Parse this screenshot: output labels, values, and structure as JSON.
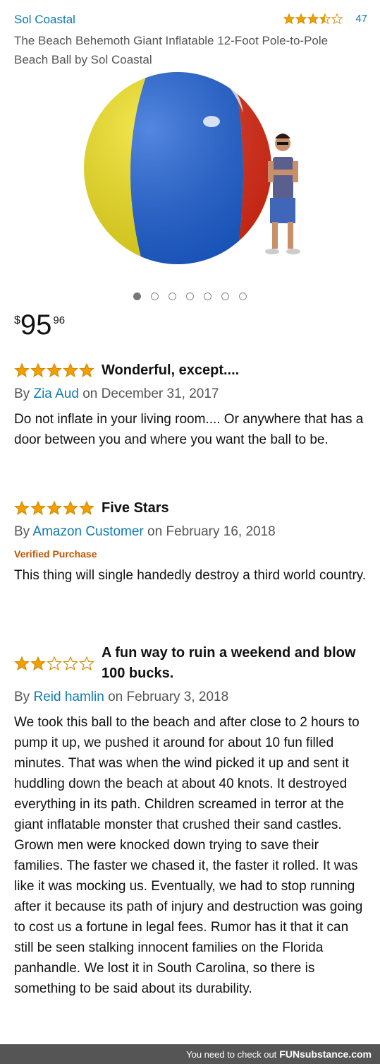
{
  "header": {
    "brand": "Sol Coastal",
    "rating": 3.5,
    "rating_count": "47",
    "product_title": "The Beach Behemoth Giant Inflatable 12-Foot Pole-to-Pole Beach Ball by Sol Coastal"
  },
  "carousel": {
    "total": 7,
    "active_index": 0
  },
  "price": {
    "symbol": "$",
    "whole": "95",
    "fraction": "96"
  },
  "reviews": [
    {
      "stars": 5,
      "title": "Wonderful, except....",
      "by": "By",
      "author": "Zia Aud",
      "date": "on December 31, 2017",
      "verified": "",
      "body": "Do not inflate in your living room.... Or anywhere that has a door between you and where you want the ball to be."
    },
    {
      "stars": 5,
      "title": "Five Stars",
      "by": "By",
      "author": "Amazon Customer",
      "date": "on February 16, 2018",
      "verified": "Verified Purchase",
      "body": "This thing will single handedly destroy a third world country."
    },
    {
      "stars": 2,
      "title": "A fun way to ruin a weekend and blow 100 bucks.",
      "by": "By",
      "author": "Reid hamlin",
      "date": "on February 3, 2018",
      "verified": "",
      "body": "We took this ball to the beach and after close to 2 hours to pump it up, we pushed it around for about 10 fun filled minutes. That was when the wind picked it up and sent it huddling down the beach at about 40 knots. It destroyed everything in its path. Children screamed in terror at the giant inflatable monster that crushed their sand castles. Grown men were knocked down trying to save their families. The faster we chased it, the faster it rolled. It was like it was mocking us. Eventually, we had to stop running after it because its path of injury and destruction was going to cost us a fortune in legal fees. Rumor has it that it can still be seen stalking innocent families on the Florida panhandle. We lost it in South Carolina, so there is something to be said about its durability."
    }
  ],
  "footer": {
    "text": "You need to check out",
    "logo": "FUNsubstance.com"
  },
  "colors": {
    "link": "#0f7bb1",
    "star": "#f0a000",
    "verified": "#c45500"
  }
}
